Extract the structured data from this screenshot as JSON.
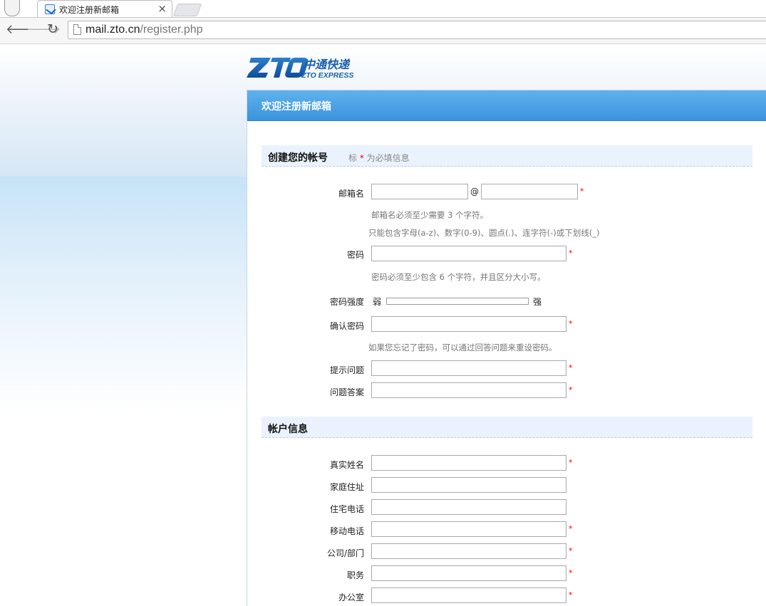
{
  "browser": {
    "tab_title": "欢迎注册新邮箱",
    "tab_close": "×",
    "url_host": "mail.zto.cn",
    "url_path": "/register.php"
  },
  "logo": {
    "mark": "ZTO",
    "cn": "中通快递",
    "en": "ZTO EXPRESS"
  },
  "panel": {
    "title": "欢迎注册新邮箱"
  },
  "section_account": {
    "title": "创建您的帐号",
    "note_prefix": "标",
    "note_star": "*",
    "note_suffix": "为必填信息"
  },
  "fields": {
    "mailbox_label": "邮箱名",
    "mailbox_at": "@",
    "mailbox_hint1": "邮箱名必须至少需要 3 个字符。",
    "mailbox_hint2": "只能包含字母(a-z)、数字(0-9)、圆点(.)、连字符(-)或下划线(_)",
    "password_label": "密码",
    "password_hint": "密码必须至少包含 6 个字符，并且区分大小写。",
    "strength_label": "密码强度",
    "strength_weak": "弱",
    "strength_strong": "强",
    "confirm_label": "确认密码",
    "confirm_hint": "如果您忘记了密码，可以通过回答问题来重设密码。",
    "question_label": "提示问题",
    "answer_label": "问题答案"
  },
  "section_profile": {
    "title": "帐户信息"
  },
  "profile": {
    "realname_label": "真实姓名",
    "address_label": "家庭住址",
    "homephone_label": "住宅电话",
    "mobile_label": "移动电话",
    "company_label": "公司/部门",
    "position_label": "职务",
    "office_label": "办公室"
  },
  "required_mark": "*"
}
